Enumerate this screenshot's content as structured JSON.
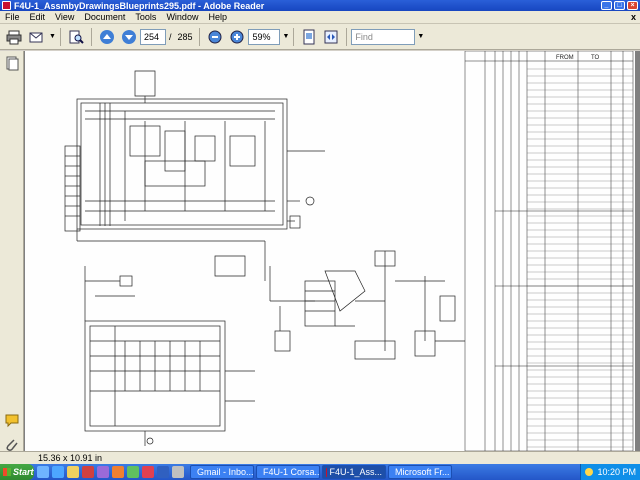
{
  "window": {
    "title": "F4U-1_AssmbyDrawingsBlueprints295.pdf - Adobe Reader"
  },
  "menu": {
    "items": [
      "File",
      "Edit",
      "View",
      "Document",
      "Tools",
      "Window",
      "Help"
    ],
    "close_glyph": "x"
  },
  "toolbar": {
    "current_page": "254",
    "page_separator": "/",
    "total_pages": "285",
    "zoom": "59%",
    "find_placeholder": "Find"
  },
  "document": {
    "column_headers": [
      "FROM",
      "TO"
    ]
  },
  "statusbar": {
    "page_size": "15.36 x 10.91 in"
  },
  "taskbar": {
    "start_label": "Start",
    "tasks": [
      {
        "label": "Gmail - Inbo..."
      },
      {
        "label": "F4U-1 Corsa..."
      },
      {
        "label": "F4U-1_Ass..."
      },
      {
        "label": "Microsoft Fr..."
      }
    ],
    "clock": "10:20 PM"
  },
  "colors": {
    "title_bar": "#2a5fd8",
    "taskbar": "#2456c8",
    "start_button": "#3a9a3a",
    "chrome": "#ece9d8"
  }
}
